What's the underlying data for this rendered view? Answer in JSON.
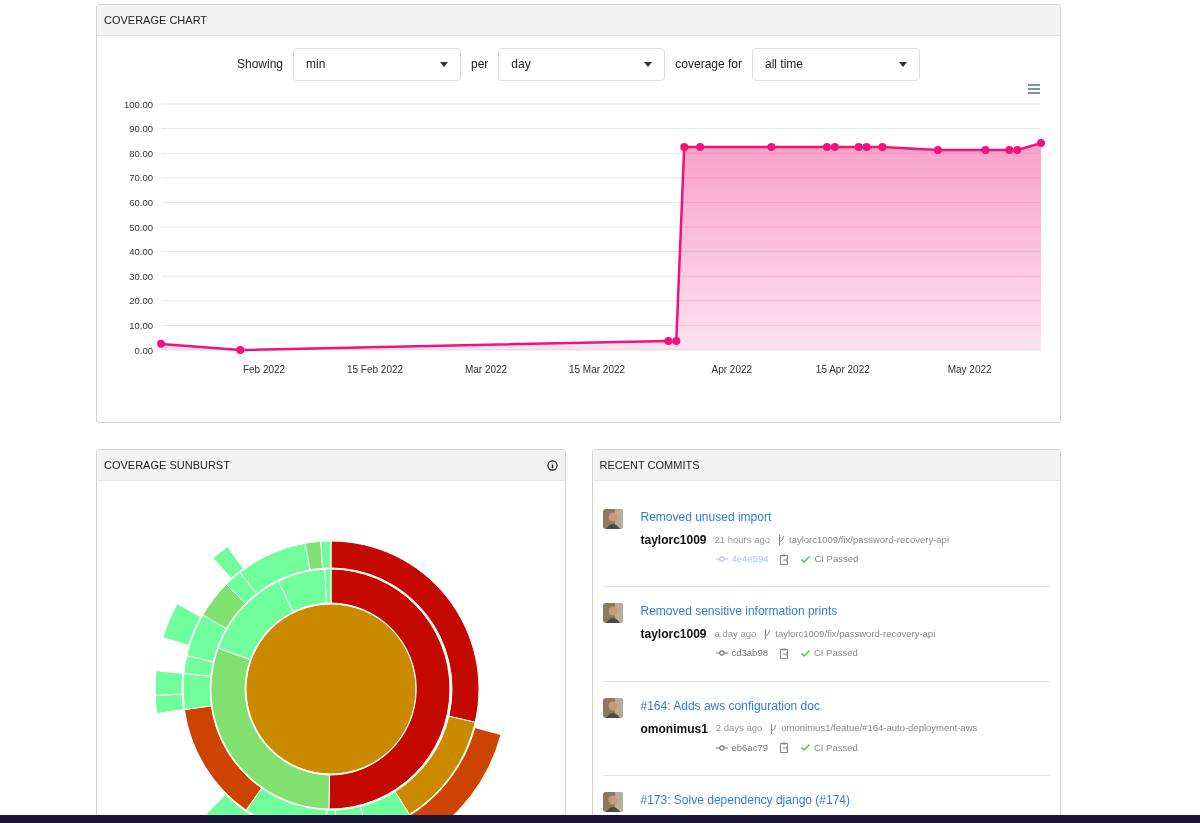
{
  "coverage_chart": {
    "title": "COVERAGE CHART",
    "filters": [
      {
        "label": "Showing",
        "value": "min"
      },
      {
        "label": "per",
        "value": "day"
      },
      {
        "label": "coverage for",
        "value": "all time"
      }
    ],
    "chart_data": {
      "type": "area",
      "grid": true,
      "xlim": [
        "2022-01-19",
        "2022-05-10"
      ],
      "ylim": [
        0,
        100
      ],
      "yticks": [
        {
          "value": 0,
          "label": "0.00"
        },
        {
          "value": 10,
          "label": "10.00"
        },
        {
          "value": 20,
          "label": "20.00"
        },
        {
          "value": 30,
          "label": "30.00"
        },
        {
          "value": 40,
          "label": "40.00"
        },
        {
          "value": 50,
          "label": "50.00"
        },
        {
          "value": 60,
          "label": "60.00"
        },
        {
          "value": 70,
          "label": "70.00"
        },
        {
          "value": 80,
          "label": "80.00"
        },
        {
          "value": 90,
          "label": "90.00"
        },
        {
          "value": 100,
          "label": "100.00"
        }
      ],
      "xticks": [
        {
          "value": "2022-02-01",
          "label": "Feb 2022"
        },
        {
          "value": "2022-02-15",
          "label": "15 Feb 2022"
        },
        {
          "value": "2022-03-01",
          "label": "Mar 2022"
        },
        {
          "value": "2022-03-15",
          "label": "15 Mar 2022"
        },
        {
          "value": "2022-04-01",
          "label": "Apr 2022"
        },
        {
          "value": "2022-04-15",
          "label": "15 Apr 2022"
        },
        {
          "value": "2022-05-01",
          "label": "May 2022"
        }
      ],
      "x": [
        "2022-01-19",
        "2022-01-29",
        "2022-03-24",
        "2022-03-25",
        "2022-03-26",
        "2022-03-28",
        "2022-04-06",
        "2022-04-13",
        "2022-04-14",
        "2022-04-17",
        "2022-04-18",
        "2022-04-20",
        "2022-04-27",
        "2022-05-03",
        "2022-05-06",
        "2022-05-07",
        "2022-05-10"
      ],
      "series": [
        {
          "color": "#f0147a",
          "values": [
            2.5,
            0,
            3.7,
            3.7,
            82.5,
            82.5,
            82.5,
            82.5,
            82.5,
            82.5,
            82.5,
            82.5,
            81.3,
            81.3,
            81.3,
            81.3,
            84.1
          ]
        }
      ]
    }
  },
  "sunburst": {
    "title": "COVERAGE SUNBURST"
  },
  "recent_commits": {
    "title": "RECENT COMMITS",
    "commits": [
      {
        "title": "Removed unused import",
        "author": "taylorc1009",
        "time": "21 hours ago",
        "branch": "taylorc1009/fix/password-recovery-api",
        "hash": "4e4e594",
        "hash_highlighted": true,
        "ci": "CI Passed"
      },
      {
        "title": "Removed sensitive information prints",
        "author": "taylorc1009",
        "time": "a day ago",
        "branch": "taylorc1009/fix/password-recovery-api",
        "hash": "cd3ab98",
        "hash_highlighted": false,
        "ci": "CI Passed"
      },
      {
        "title": "#164: Adds aws configuration doc",
        "author": "omonimus1",
        "time": "2 days ago",
        "branch": "omonimus1/featue/#164-auto-deployment-aws",
        "hash": "eb6ac79",
        "hash_highlighted": false,
        "ci": "CI Passed"
      },
      {
        "title": "#173: Solve dependency django (#174)"
      }
    ]
  }
}
